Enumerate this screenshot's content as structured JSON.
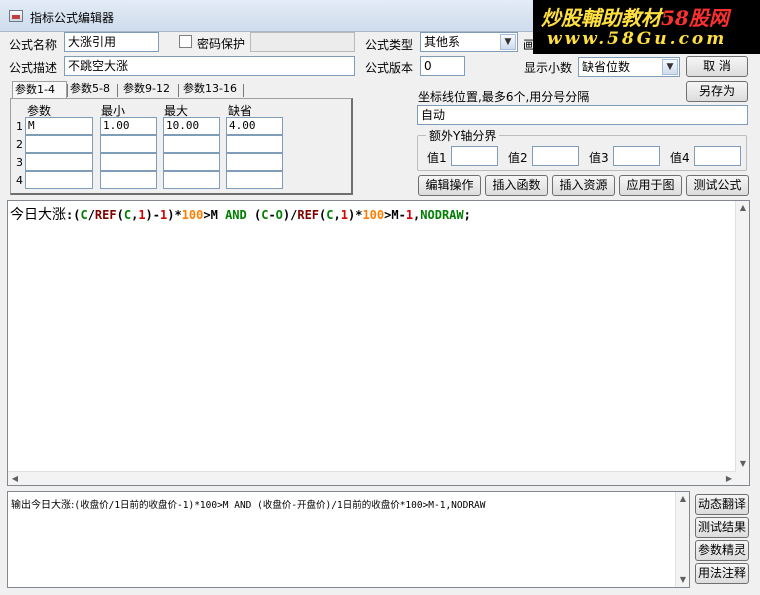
{
  "window": {
    "title": "指标公式编辑器"
  },
  "watermark": {
    "line1_a": "炒股輔助教材",
    "line1_b": "58股网",
    "line2": "www.58Gu.com"
  },
  "form": {
    "name_label": "公式名称",
    "name_value": "大涨引用",
    "password_label": "密码保护",
    "password_value": "",
    "desc_label": "公式描述",
    "desc_value": "不跳空大涨",
    "type_label": "公式类型",
    "type_value": "其他系",
    "partial_label": "画",
    "version_label": "公式版本",
    "version_value": "0",
    "decimals_label": "显示小数",
    "decimals_value": "缺省位数"
  },
  "buttons": {
    "cancel": "取  消",
    "save_as": "另存为",
    "edit_ops": "编辑操作",
    "insert_func": "插入函数",
    "insert_res": "插入资源",
    "apply_chart": "应用于图",
    "test_formula": "测试公式",
    "dynamic_translate": "动态翻译",
    "test_result": "测试结果",
    "param_wizard": "参数精灵",
    "usage_notes": "用法注释"
  },
  "tabs": [
    "参数1-4",
    "参数5-8",
    "参数9-12",
    "参数13-16"
  ],
  "params": {
    "headers": [
      "参数",
      "最小",
      "最大",
      "缺省"
    ],
    "rows": [
      {
        "num": "1",
        "name": "M",
        "min": "1.00",
        "max": "10.00",
        "default": "4.00"
      },
      {
        "num": "2",
        "name": "",
        "min": "",
        "max": "",
        "default": ""
      },
      {
        "num": "3",
        "name": "",
        "min": "",
        "max": "",
        "default": ""
      },
      {
        "num": "4",
        "name": "",
        "min": "",
        "max": "",
        "default": ""
      }
    ]
  },
  "axis": {
    "label": "坐标线位置,最多6个,用分号分隔",
    "value": "自动",
    "group_title": "额外Y轴分界",
    "v1_label": "值1",
    "v2_label": "值2",
    "v3_label": "值3",
    "v4_label": "值4",
    "v1": "",
    "v2": "",
    "v3": "",
    "v4": ""
  },
  "code": {
    "title": "今日大涨",
    "tokens": [
      {
        "t": ":(",
        "c": "blk"
      },
      {
        "t": "C",
        "c": "grn"
      },
      {
        "t": "/",
        "c": "blk"
      },
      {
        "t": "REF",
        "c": "fun"
      },
      {
        "t": "(",
        "c": "blk"
      },
      {
        "t": "C",
        "c": "grn"
      },
      {
        "t": ",",
        "c": "blk"
      },
      {
        "t": "1",
        "c": "red"
      },
      {
        "t": ")-",
        "c": "blk"
      },
      {
        "t": "1",
        "c": "red"
      },
      {
        "t": ")*",
        "c": "blk"
      },
      {
        "t": "100",
        "c": "org"
      },
      {
        "t": ">M ",
        "c": "blk"
      },
      {
        "t": "AND",
        "c": "kw"
      },
      {
        "t": " (",
        "c": "blk"
      },
      {
        "t": "C",
        "c": "grn"
      },
      {
        "t": "-",
        "c": "blk"
      },
      {
        "t": "O",
        "c": "grn"
      },
      {
        "t": ")/",
        "c": "blk"
      },
      {
        "t": "REF",
        "c": "fun"
      },
      {
        "t": "(",
        "c": "blk"
      },
      {
        "t": "C",
        "c": "grn"
      },
      {
        "t": ",",
        "c": "blk"
      },
      {
        "t": "1",
        "c": "red"
      },
      {
        "t": ")*",
        "c": "blk"
      },
      {
        "t": "100",
        "c": "org"
      },
      {
        "t": ">M-",
        "c": "blk"
      },
      {
        "t": "1",
        "c": "red"
      },
      {
        "t": ",",
        "c": "blk"
      },
      {
        "t": "NODRAW",
        "c": "kw"
      },
      {
        "t": ";",
        "c": "blk"
      }
    ]
  },
  "output": {
    "prefix": "输出今日大涨:",
    "body": "(收盘价/1日前的收盘价-1)*100>M AND (收盘价-开盘价)/1日前的收盘价*100>M-1,NODRAW"
  },
  "colors": {
    "accent": "#7f9db9",
    "code_green": "#008000",
    "code_red": "#d80000",
    "code_orange": "#ff8000",
    "code_fun": "#800000"
  }
}
